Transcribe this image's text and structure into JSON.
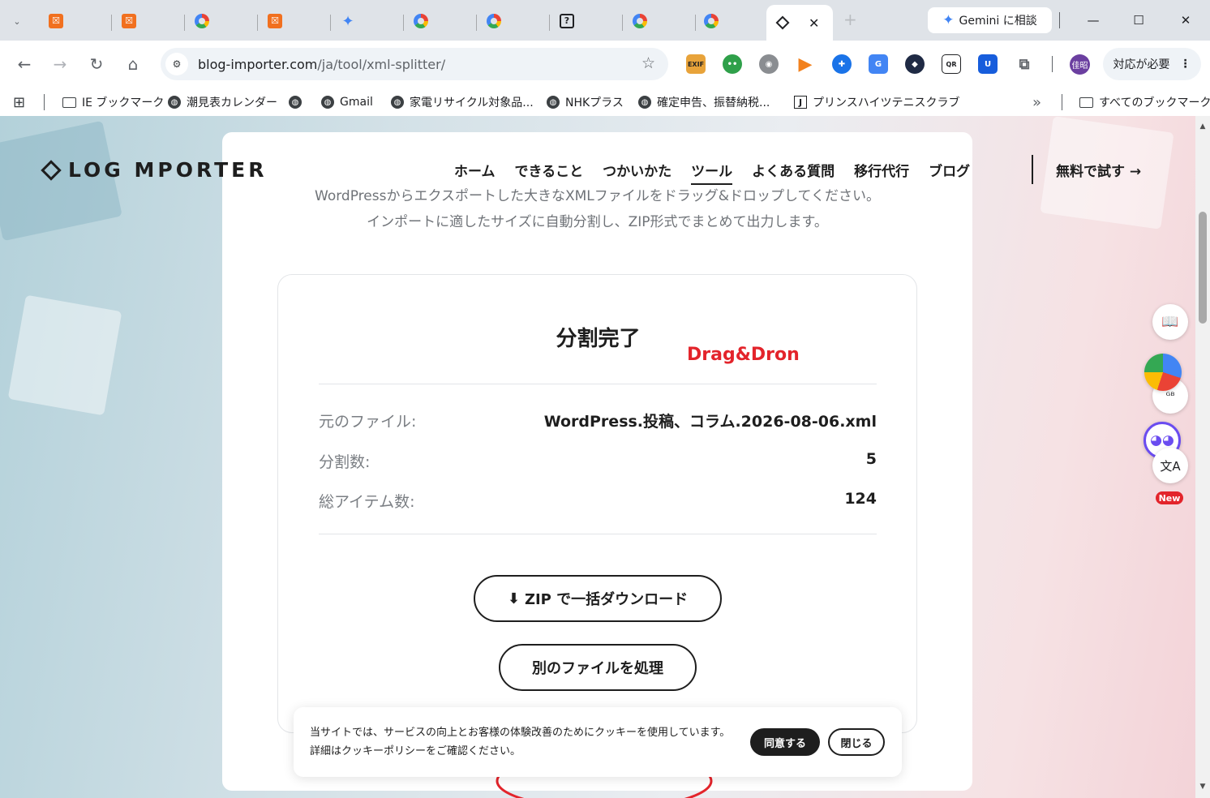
{
  "browser": {
    "tabs": [
      {
        "favicon": "xampp-icon"
      },
      {
        "favicon": "xampp-icon"
      },
      {
        "favicon": "google-icon"
      },
      {
        "favicon": "xampp-icon"
      },
      {
        "favicon": "gemini-icon"
      },
      {
        "favicon": "google-icon"
      },
      {
        "favicon": "google-icon"
      },
      {
        "favicon": "question-icon"
      },
      {
        "favicon": "google-icon"
      },
      {
        "favicon": "google-icon"
      }
    ],
    "active_tab": {
      "favicon": "blog-importer-icon",
      "close": "✕"
    },
    "gemini_button": "Gemini に相談",
    "window_controls": {
      "minimize": "—",
      "maximize": "☐",
      "close": "✕"
    },
    "url_domain": "blog-importer.com",
    "url_path": "/ja/tool/xml-splitter/",
    "profile_initials": "佳昭",
    "action_button": "対応が必要",
    "extensions": [
      "EXIF",
      "●",
      "◉",
      "▶",
      "✚",
      "G",
      "◆",
      "QR",
      "U",
      "⬚"
    ]
  },
  "bookmarks": {
    "items": [
      {
        "label": "IE ブックマーク",
        "icon": "folder-icon"
      },
      {
        "label": "潮見表カレンダー",
        "icon": "globe-icon"
      },
      {
        "label": "",
        "icon": "globe-icon"
      },
      {
        "label": "Gmail",
        "icon": "globe-icon"
      },
      {
        "label": "家電リサイクル対象品...",
        "icon": "globe-icon"
      },
      {
        "label": "NHKプラス",
        "icon": "globe-icon"
      },
      {
        "label": "確定申告、振替納税...",
        "icon": "globe-icon"
      },
      {
        "label": "プリンスハイツテニスクラブ",
        "icon": "j-icon"
      }
    ],
    "overflow": "»",
    "all_bookmarks": "すべてのブックマーク"
  },
  "site": {
    "logo": "LOG MPORTER",
    "nav": [
      "ホーム",
      "できること",
      "つかいかた",
      "ツール",
      "よくある質問",
      "移行代行",
      "ブログ"
    ],
    "active_nav": "ツール",
    "try_free": "無料で試す →",
    "description_line1": "WordPressからエクスポートした大きなXMLファイルをドラッグ&ドロップしてください。",
    "description_line2": "インポートに適したサイズに自動分割し、ZIP形式でまとめて出力します。"
  },
  "result": {
    "title": "分割完了",
    "annotation": "Drag&Dron",
    "rows": [
      {
        "label": "元のファイル:",
        "value": "WordPress.投稿、コラム.2026-08-06.xml"
      },
      {
        "label": "分割数:",
        "value": "5"
      },
      {
        "label": "総アイテム数:",
        "value": "124"
      }
    ],
    "download_button": "ZIP で一括ダウンロード",
    "download_icon": "⬇",
    "other_file_button": "別のファイルを処理",
    "highlight_color": "#e3242b"
  },
  "cookie": {
    "text": "当サイトでは、サービスの向上とお客様の体験改善のためにクッキーを使用しています。詳細はクッキーポリシーをご確認ください。",
    "agree": "同意する",
    "close": "閉じる"
  },
  "sidebar": {
    "new_badge": "New"
  }
}
